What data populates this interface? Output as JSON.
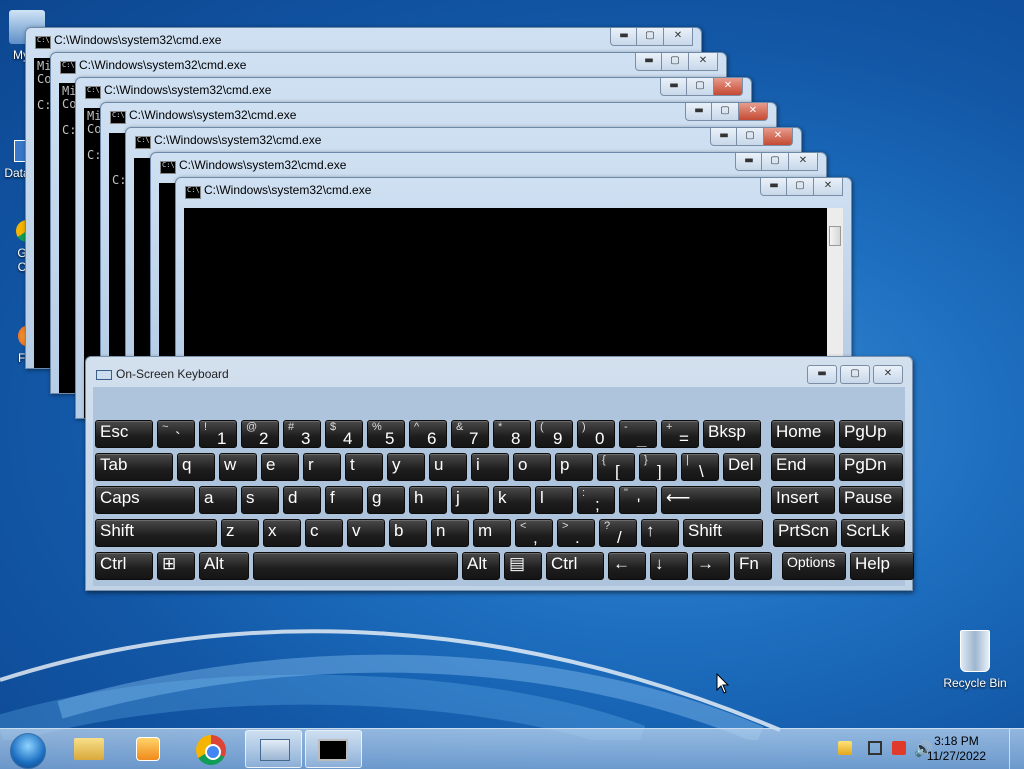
{
  "desktop": {
    "icons": [
      {
        "label": "My C",
        "icon": "computer-icon"
      },
      {
        "label": "Data",
        "icon": "app-icon"
      },
      {
        "label": "G\nC",
        "icon": "chrome-icon"
      },
      {
        "label": "Firefo",
        "icon": "firefox-icon"
      },
      {
        "label": "Recycle Bin",
        "icon": "recycle-bin-icon"
      }
    ]
  },
  "cmd_windows": {
    "title": "C:\\Windows\\system32\\cmd.exe",
    "console_lines": {
      "w1": "Mi\nCo\n\nC:",
      "w2": "Mi\nCo\n\nC:",
      "w3": "Mi\nCo\n\nC:",
      "w4": "\n\n\nC:"
    },
    "buttons": {
      "minimize": "▬",
      "maximize": "▢",
      "close": "✕"
    }
  },
  "osk": {
    "title": "On-Screen Keyboard",
    "rows": [
      [
        {
          "main": "Esc"
        },
        {
          "shift": "~",
          "main": "`"
        },
        {
          "shift": "!",
          "main": "1"
        },
        {
          "shift": "@",
          "main": "2"
        },
        {
          "shift": "#",
          "main": "3"
        },
        {
          "shift": "$",
          "main": "4"
        },
        {
          "shift": "%",
          "main": "5"
        },
        {
          "shift": "^",
          "main": "6"
        },
        {
          "shift": "&",
          "main": "7"
        },
        {
          "shift": "*",
          "main": "8"
        },
        {
          "shift": "(",
          "main": "9"
        },
        {
          "shift": ")",
          "main": "0"
        },
        {
          "shift": "-",
          "main": "_"
        },
        {
          "shift": "+",
          "main": "="
        },
        {
          "main": "Bksp"
        },
        {
          "main": "Home"
        },
        {
          "main": "PgUp"
        }
      ],
      [
        {
          "main": "Tab"
        },
        {
          "main": "q"
        },
        {
          "main": "w"
        },
        {
          "main": "e"
        },
        {
          "main": "r"
        },
        {
          "main": "t"
        },
        {
          "main": "y"
        },
        {
          "main": "u"
        },
        {
          "main": "i"
        },
        {
          "main": "o"
        },
        {
          "main": "p"
        },
        {
          "shift": "{",
          "main": "["
        },
        {
          "shift": "}",
          "main": "]"
        },
        {
          "shift": "|",
          "main": "\\"
        },
        {
          "main": "Del"
        },
        {
          "main": "End"
        },
        {
          "main": "PgDn"
        }
      ],
      [
        {
          "main": "Caps"
        },
        {
          "main": "a"
        },
        {
          "main": "s"
        },
        {
          "main": "d"
        },
        {
          "main": "f"
        },
        {
          "main": "g"
        },
        {
          "main": "h"
        },
        {
          "main": "j"
        },
        {
          "main": "k"
        },
        {
          "main": "l"
        },
        {
          "shift": ":",
          "main": ";"
        },
        {
          "shift": "\"",
          "main": "'"
        },
        {
          "main": "⟵"
        },
        {
          "main": "Insert"
        },
        {
          "main": "Pause"
        }
      ],
      [
        {
          "main": "Shift"
        },
        {
          "main": "z"
        },
        {
          "main": "x"
        },
        {
          "main": "c"
        },
        {
          "main": "v"
        },
        {
          "main": "b"
        },
        {
          "main": "n"
        },
        {
          "main": "m"
        },
        {
          "shift": "<",
          "main": ","
        },
        {
          "shift": ">",
          "main": "."
        },
        {
          "shift": "?",
          "main": "/"
        },
        {
          "main": "↑"
        },
        {
          "main": "Shift"
        },
        {
          "main": "PrtScn"
        },
        {
          "main": "ScrLk"
        }
      ],
      [
        {
          "main": "Ctrl"
        },
        {
          "main": "⊞"
        },
        {
          "main": "Alt"
        },
        {
          "main": ""
        },
        {
          "main": "Alt"
        },
        {
          "main": "▤"
        },
        {
          "main": "Ctrl"
        },
        {
          "main": "←"
        },
        {
          "main": "↓"
        },
        {
          "main": "→"
        },
        {
          "main": "Fn"
        },
        {
          "main": "Options"
        },
        {
          "main": "Help"
        }
      ]
    ]
  },
  "taskbar": {
    "clock_time": "3:18 PM",
    "clock_date": "11/27/2022"
  }
}
